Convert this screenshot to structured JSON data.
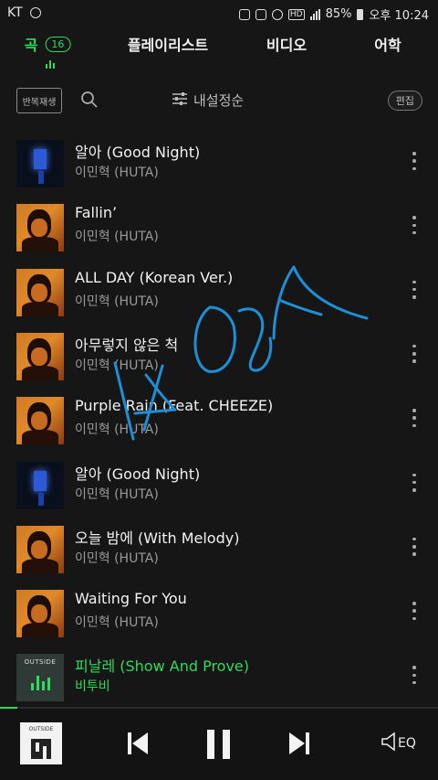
{
  "status": {
    "carrier": "KT",
    "hd": "HD",
    "battery": "85%",
    "time": "오후 10:24"
  },
  "tabs": [
    {
      "label": "곡",
      "badge": "16",
      "active": true
    },
    {
      "label": "플레이리스트"
    },
    {
      "label": "비디오"
    },
    {
      "label": "어학"
    }
  ],
  "toolbar": {
    "repeat_label": "반복재생",
    "sort_label": "내설정순",
    "edit_label": "편집"
  },
  "tracks": [
    {
      "title": "알아 (Good Night)",
      "artist": "이민혁 (HUTA)",
      "art": "night"
    },
    {
      "title": "Fallin’",
      "artist": "이민혁 (HUTA)",
      "art": "huta"
    },
    {
      "title": "ALL DAY (Korean Ver.)",
      "artist": "이민혁 (HUTA)",
      "art": "huta"
    },
    {
      "title": "아무렇지 않은 척",
      "artist": "이민혁 (HUTA)",
      "art": "huta"
    },
    {
      "title": "Purple Rain (Feat. CHEEZE)",
      "artist": "이민혁 (HUTA)",
      "art": "huta"
    },
    {
      "title": "알아 (Good Night)",
      "artist": "이민혁 (HUTA)",
      "art": "night"
    },
    {
      "title": "오늘 밤에 (With Melody)",
      "artist": "이민혁 (HUTA)",
      "art": "huta"
    },
    {
      "title": "Waiting For You",
      "artist": "이민혁 (HUTA)",
      "art": "huta"
    },
    {
      "title": "피날레 (Show And Prove)",
      "artist": "비투비",
      "art": "outside",
      "playing": true
    }
  ],
  "album_label": "OUTSIDE",
  "player": {
    "progress": 0.04,
    "eq_label": "EQ"
  },
  "colors": {
    "accent": "#2bdc5e",
    "background": "#161616",
    "scribble": "#1e8fd6"
  }
}
